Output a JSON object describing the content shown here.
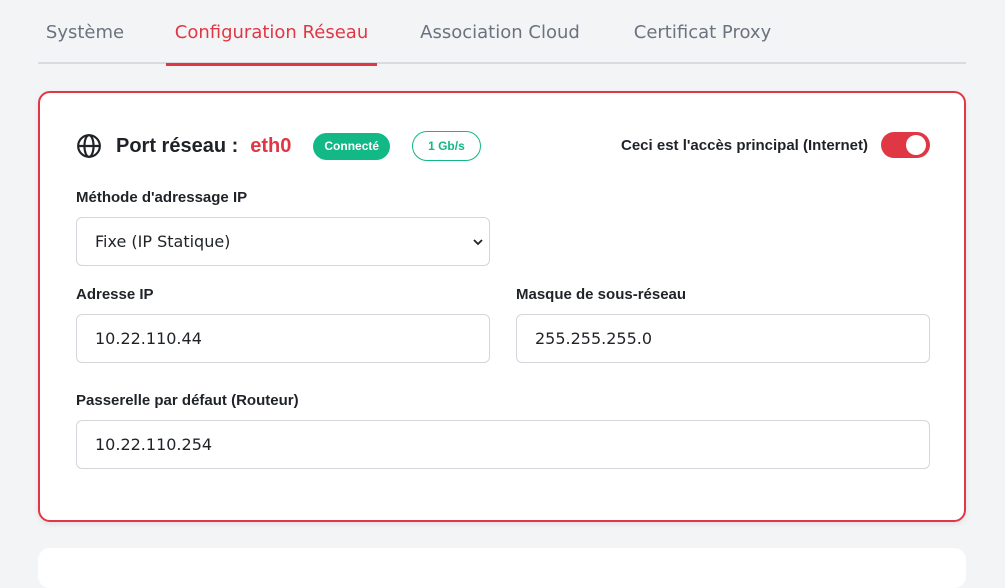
{
  "tabs": [
    {
      "label": "Système",
      "active": false
    },
    {
      "label": "Configuration Réseau",
      "active": true
    },
    {
      "label": "Association Cloud",
      "active": false
    },
    {
      "label": "Certificat Proxy",
      "active": false
    }
  ],
  "port": {
    "icon": "globe-icon",
    "label": "Port réseau :",
    "name": "eth0",
    "status": "Connecté",
    "speed": "1 Gb/s",
    "primary_label": "Ceci est l'accès principal (Internet)",
    "primary_enabled": true
  },
  "form": {
    "method_label": "Méthode d'adressage IP",
    "method_value": "Fixe (IP Statique)",
    "ip_label": "Adresse IP",
    "ip_value": "10.22.110.44",
    "mask_label": "Masque de sous-réseau",
    "mask_value": "255.255.255.0",
    "gateway_label": "Passerelle par défaut (Routeur)",
    "gateway_value": "10.22.110.254"
  },
  "colors": {
    "accent": "#e03744",
    "success": "#12b886",
    "muted_text": "#6b7280",
    "background": "#f3f4f6"
  }
}
